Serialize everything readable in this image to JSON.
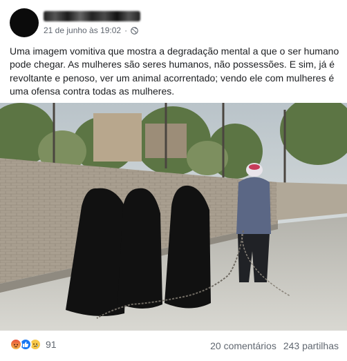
{
  "post": {
    "author": {
      "name_redacted": true,
      "timestamp": "21 de junho às 19:02",
      "privacy_icon": "globe-icon"
    },
    "caption": "Uma imagem vomitiva que mostra a degradação mental a que o ser humano pode chegar. As mulheres são seres humanos, não possessões. E sim, já é revoltante e penoso, ver um animal acorrentado; vendo ele com mulheres é uma ofensa contra todas as mulheres.",
    "image": {
      "content": "photo"
    },
    "reactions": {
      "icons": [
        "angry-reaction-icon",
        "like-reaction-icon",
        "sad-reaction-icon"
      ],
      "count": "91"
    },
    "stats": {
      "comments": "20 comentários",
      "shares": "243 partilhas"
    }
  },
  "colors": {
    "meta_text": "#606770",
    "body_text": "#1c1e21",
    "like_blue": "#1877f2"
  }
}
